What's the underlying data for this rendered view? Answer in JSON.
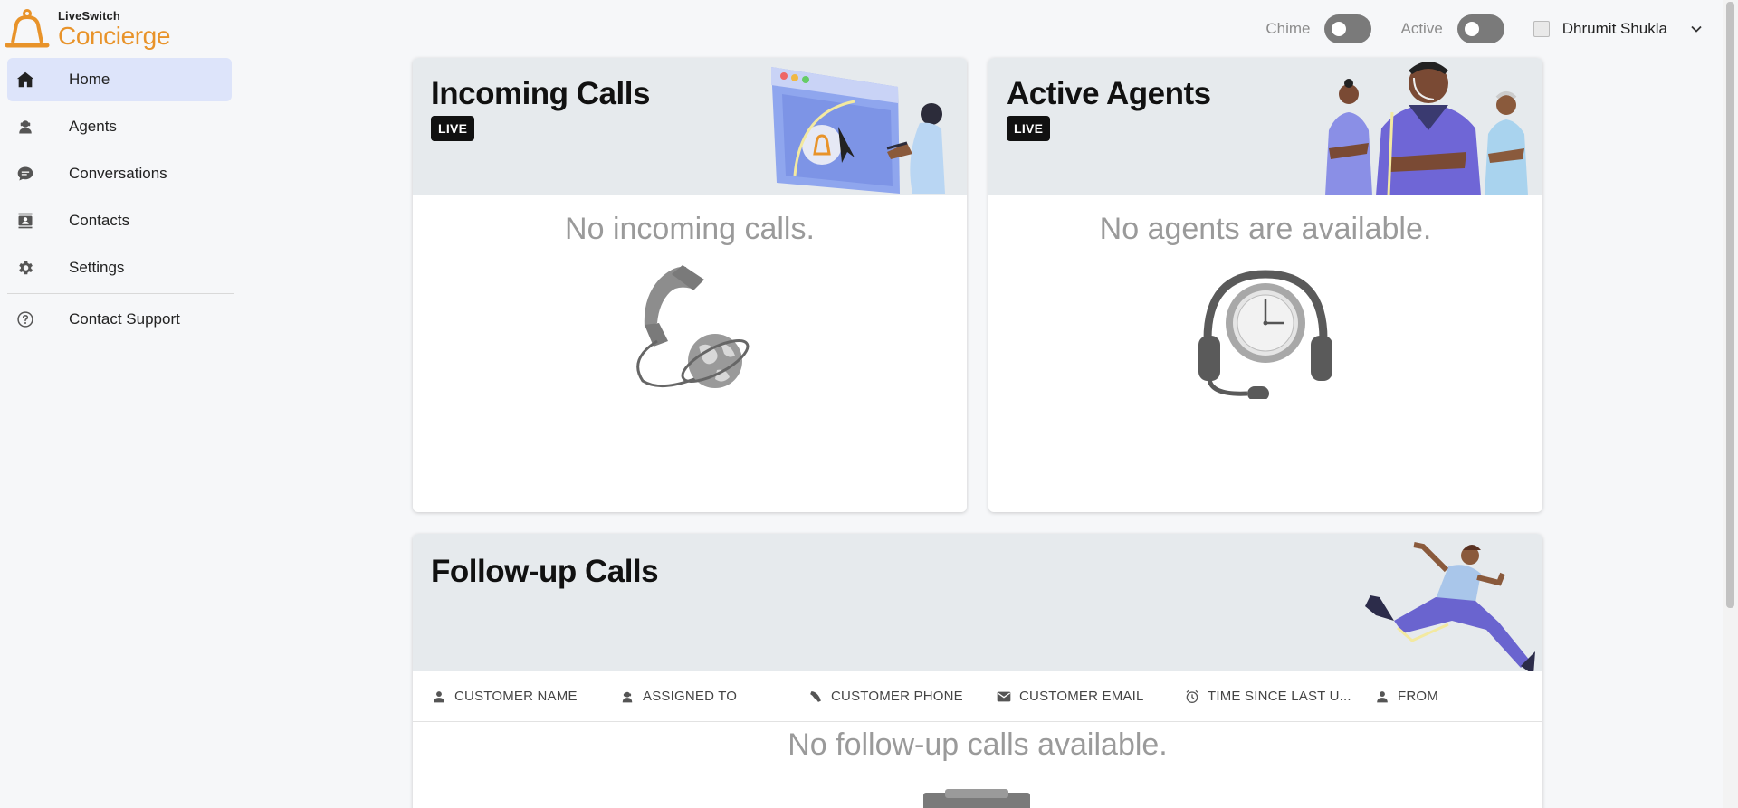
{
  "brand": {
    "small": "LiveSwitch",
    "big": "Concierge",
    "accent": "#e8932a"
  },
  "sidebar": {
    "items": [
      {
        "label": "Home",
        "icon": "home-icon",
        "active": true
      },
      {
        "label": "Agents",
        "icon": "agent-icon"
      },
      {
        "label": "Conversations",
        "icon": "chat-icon"
      },
      {
        "label": "Contacts",
        "icon": "contacts-icon"
      },
      {
        "label": "Settings",
        "icon": "gear-icon"
      }
    ],
    "support": {
      "label": "Contact Support",
      "icon": "help-icon"
    }
  },
  "topbar": {
    "chime_label": "Chime",
    "active_label": "Active",
    "chime_on": false,
    "active_on": false,
    "user_name": "Dhrumit Shukla"
  },
  "incoming": {
    "title": "Incoming Calls",
    "badge": "LIVE",
    "empty": "No incoming calls."
  },
  "agents": {
    "title": "Active Agents",
    "badge": "LIVE",
    "empty": "No agents are available."
  },
  "followup": {
    "title": "Follow-up Calls",
    "columns": [
      "CUSTOMER NAME",
      "ASSIGNED TO",
      "CUSTOMER PHONE",
      "CUSTOMER EMAIL",
      "TIME SINCE LAST U...",
      "FROM"
    ],
    "empty": "No follow-up calls available."
  }
}
